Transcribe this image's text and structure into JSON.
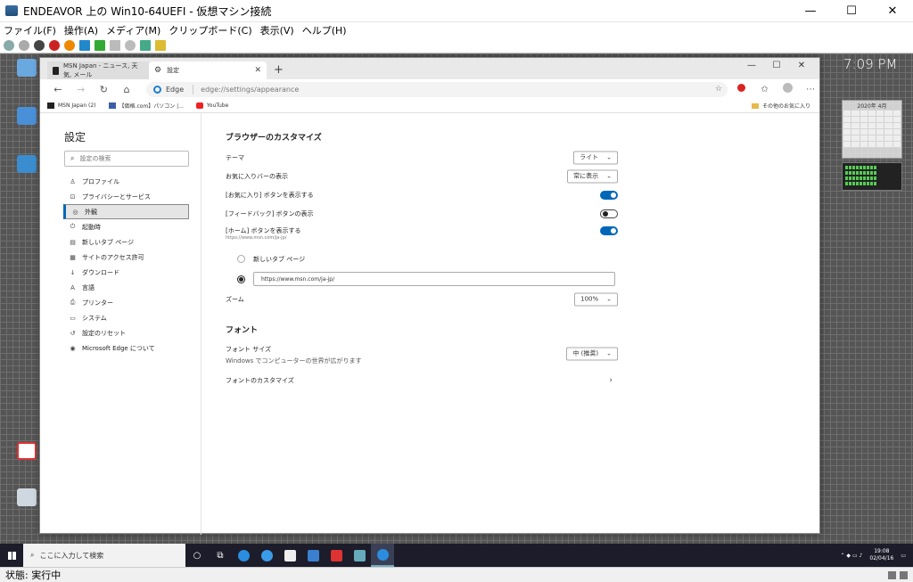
{
  "host": {
    "title": "ENDEAVOR 上の Win10-64UEFI - 仮想マシン接続",
    "menu": [
      "ファイル(F)",
      "操作(A)",
      "メディア(M)",
      "クリップボード(C)",
      "表示(V)",
      "ヘルプ(H)"
    ],
    "status": "状態: 実行中"
  },
  "desktop": {
    "clock": "7:09 PM",
    "calendar_title": "2020年 4月"
  },
  "browser": {
    "tabs": [
      {
        "title": "MSN Japan - ニュース, 天気, メール"
      },
      {
        "title": "設定"
      }
    ],
    "brand": "Edge",
    "url": "edge://settings/appearance",
    "favorites": [
      "MSN Japan (2)",
      "【価格.com】パソコン |...",
      "YouTube"
    ],
    "other_favorites": "その他のお気に入り"
  },
  "settings": {
    "title": "設定",
    "search_placeholder": "設定の検索",
    "nav": [
      {
        "label": "プロファイル",
        "icon": "person-icon"
      },
      {
        "label": "プライバシーとサービス",
        "icon": "lock-icon"
      },
      {
        "label": "外観",
        "icon": "palette-icon",
        "selected": true
      },
      {
        "label": "起動時",
        "icon": "power-icon"
      },
      {
        "label": "新しいタブ ページ",
        "icon": "newtab-icon"
      },
      {
        "label": "サイトのアクセス許可",
        "icon": "permissions-icon"
      },
      {
        "label": "ダウンロード",
        "icon": "download-icon"
      },
      {
        "label": "言語",
        "icon": "language-icon"
      },
      {
        "label": "プリンター",
        "icon": "printer-icon"
      },
      {
        "label": "システム",
        "icon": "system-icon"
      },
      {
        "label": "設定のリセット",
        "icon": "reset-icon"
      },
      {
        "label": "Microsoft Edge について",
        "icon": "edge-icon"
      }
    ],
    "customize_heading": "ブラウザーのカスタマイズ",
    "theme_label": "テーマ",
    "theme_value": "ライト",
    "favbar_label": "お気に入りバーの表示",
    "favbar_value": "常に表示",
    "fav_button_label": "[お気に入り] ボタンを表示する",
    "feedback_label": "[フィードバック] ボタンの表示",
    "home_label": "[ホーム] ボタンを表示する",
    "home_sub": "https://www.msn.com/ja-jp/",
    "newtab_option": "新しいタブ ページ",
    "home_url": "https://www.msn.com/ja-jp/",
    "zoom_label": "ズーム",
    "zoom_value": "100%",
    "font_heading": "フォント",
    "font_size_label": "フォント サイズ",
    "font_size_desc": "Windows でコンピューターの世界が広がります",
    "font_size_value": "中 (推奨)",
    "font_customize_label": "フォントのカスタマイズ",
    "toggles": {
      "fav_button": true,
      "feedback": false,
      "home": true
    }
  },
  "taskbar": {
    "search": "ここに入力して検索",
    "time": "19:08",
    "date": "02/04/16"
  }
}
